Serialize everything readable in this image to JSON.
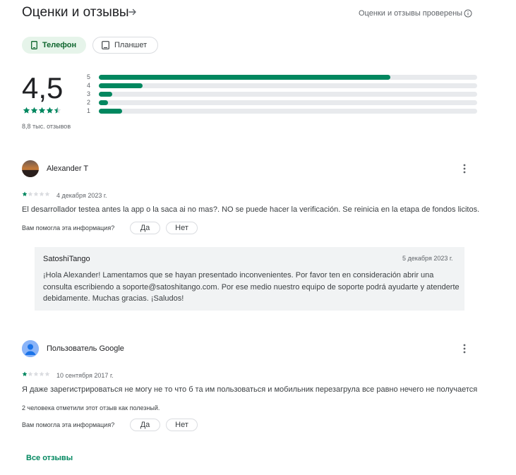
{
  "header": {
    "title": "Оценки и отзывы",
    "verified_label": "Оценки и отзывы проверены"
  },
  "device_tabs": [
    {
      "label": "Телефон",
      "selected": true
    },
    {
      "label": "Планшет",
      "selected": false
    }
  ],
  "summary": {
    "rating": "4,5",
    "stars": 4.5,
    "reviews_count": "8,8 тыс. отзывов",
    "distribution": [
      {
        "label": "5",
        "fraction": 0.77
      },
      {
        "label": "4",
        "fraction": 0.115
      },
      {
        "label": "3",
        "fraction": 0.035
      },
      {
        "label": "2",
        "fraction": 0.025
      },
      {
        "label": "1",
        "fraction": 0.062
      }
    ]
  },
  "reviews": [
    {
      "author": "Alexander T",
      "stars": 1,
      "date": "4 декабря 2023 г.",
      "text": "El desarrollador testea antes la app o la saca ai no mas?. NO se puede hacer la verificación. Se reinicia en la etapa de fondos licitos.",
      "helpful_question": "Вам помогла эта информация?",
      "yes_label": "Да",
      "no_label": "Нет",
      "reply": {
        "developer": "SatoshiTango",
        "date": "5 декабря 2023 г.",
        "text": "¡Hola Alexander! Lamentamos que se hayan presentado inconvenientes. Por favor ten en consideración abrir una consulta escribiendo a soporte@satoshitango.com. Por ese medio nuestro equipo de soporte podrá ayudarte y atenderte debidamente. Muchas gracias. ¡Saludos!"
      }
    },
    {
      "author": "Пользователь Google",
      "stars": 1,
      "date": "10 сентября 2017 г.",
      "text": "Я даже зарегистрироваться не могу не то что б та им пользоваться и мобильник перезагрула все равно нечего не получается",
      "helpful_count": "2 человека отметили этот отзыв как полезный.",
      "helpful_question": "Вам помогла эта информация?",
      "yes_label": "Да",
      "no_label": "Нет"
    }
  ],
  "all_reviews_label": "Все отзывы",
  "colors": {
    "accent": "#01875f",
    "chip_bg": "#e6f4ea",
    "bar_track": "#e8eaed",
    "reply_bg": "#f1f3f4"
  },
  "icons": {
    "title_arrow": "arrow-right-icon",
    "verified": "info-icon",
    "phone": "phone-icon",
    "tablet": "tablet-icon",
    "more": "more-vert-icon"
  }
}
